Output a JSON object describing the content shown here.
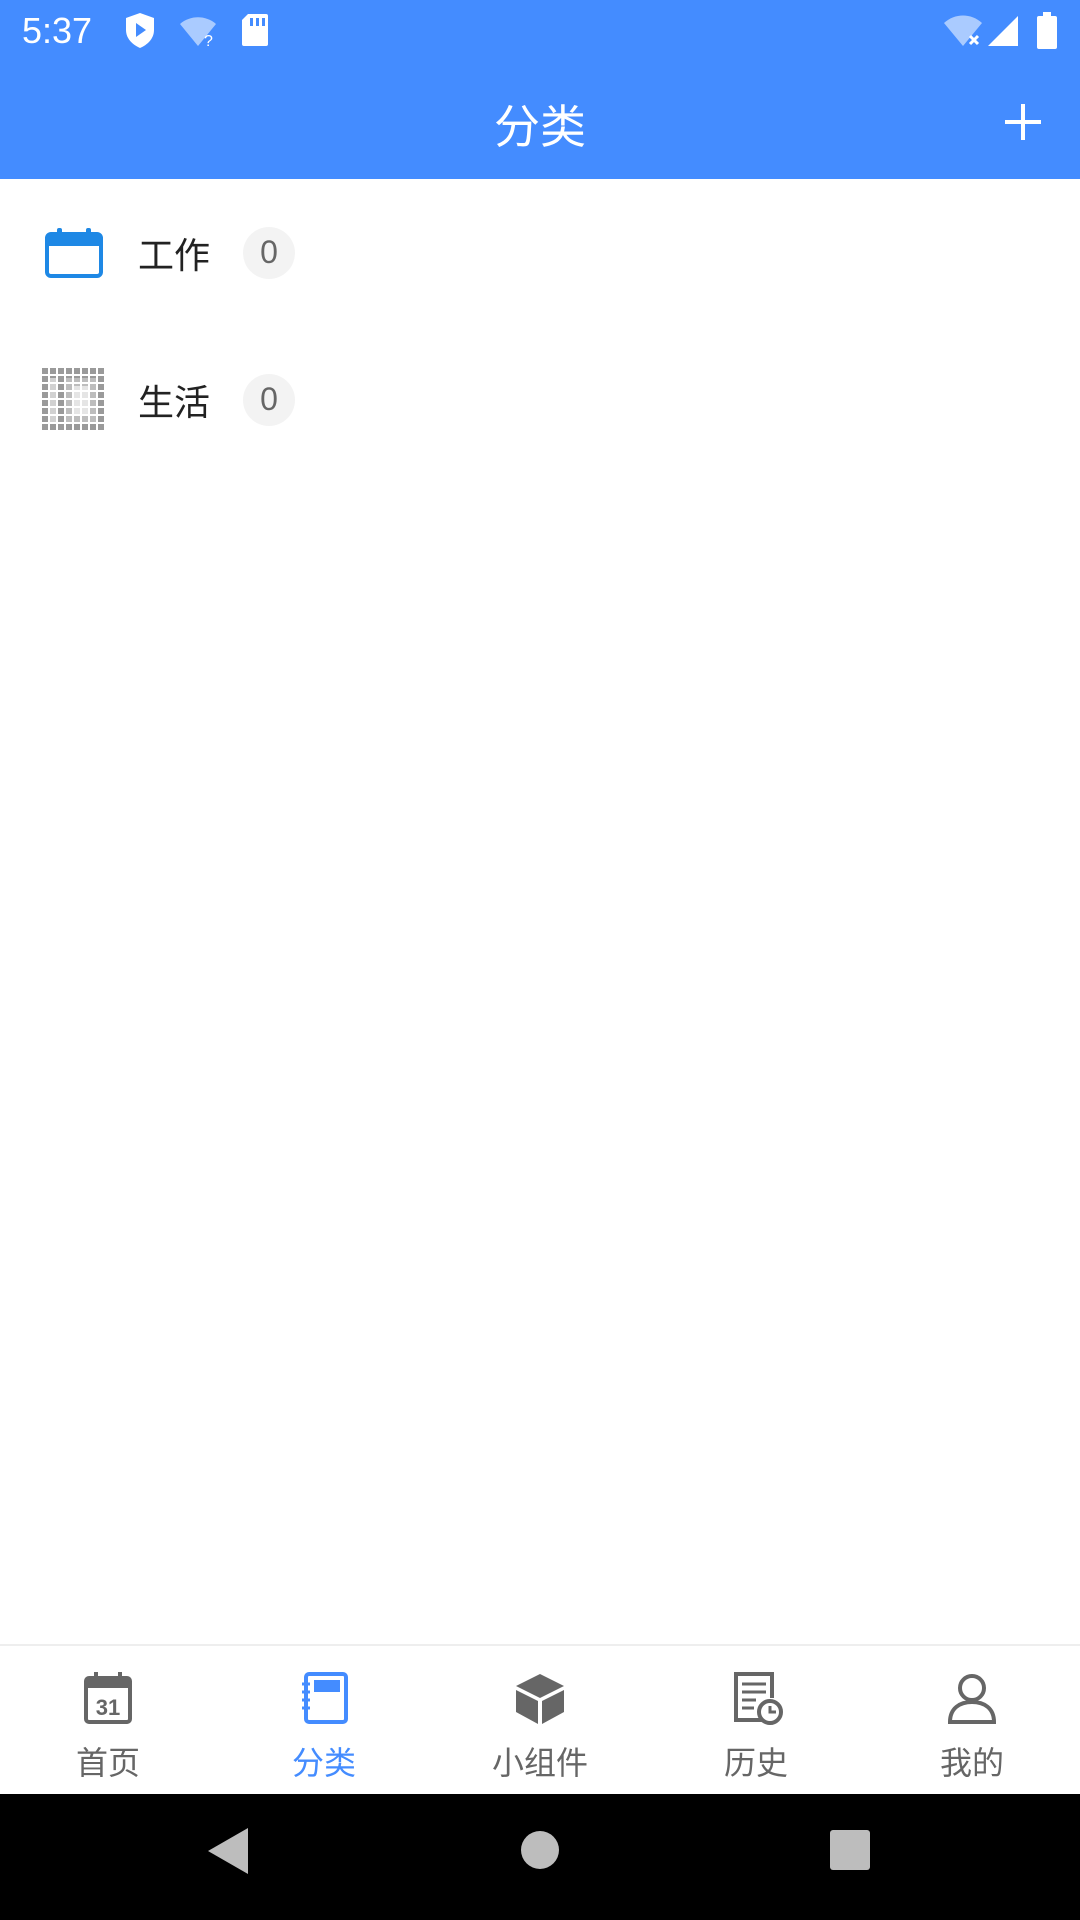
{
  "status_bar": {
    "time": "5:37"
  },
  "app_bar": {
    "title": "分类"
  },
  "categories": [
    {
      "label": "工作",
      "count": "0",
      "icon": "calendar-icon"
    },
    {
      "label": "生活",
      "count": "0",
      "icon": "grid-pattern-icon"
    }
  ],
  "bottom_nav": {
    "items": [
      {
        "label": "首页",
        "icon": "calendar-31-icon"
      },
      {
        "label": "分类",
        "icon": "notebook-icon",
        "active": true
      },
      {
        "label": "小组件",
        "icon": "cube-icon"
      },
      {
        "label": "历史",
        "icon": "history-doc-icon"
      },
      {
        "label": "我的",
        "icon": "person-icon"
      }
    ]
  },
  "colors": {
    "primary": "#448cff",
    "inactive": "#666666",
    "badge_bg": "#f3f3f3"
  }
}
